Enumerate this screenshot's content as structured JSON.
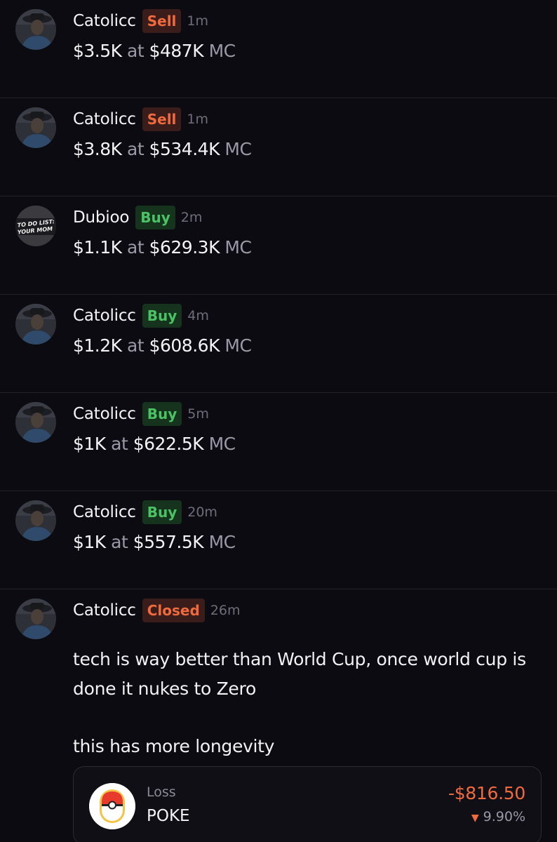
{
  "trades": [
    {
      "user": "Catolicc",
      "action": "Sell",
      "time": "1m",
      "amount": "$3.5K",
      "at": "at",
      "mc": "$487K",
      "mc_suffix": "MC"
    },
    {
      "user": "Catolicc",
      "action": "Sell",
      "time": "1m",
      "amount": "$3.8K",
      "at": "at",
      "mc": "$534.4K",
      "mc_suffix": "MC"
    },
    {
      "user": "Dubioo",
      "action": "Buy",
      "time": "2m",
      "amount": "$1.1K",
      "at": "at",
      "mc": "$629.3K",
      "mc_suffix": "MC",
      "avatar_text": [
        "TO DO LIST:",
        "YOUR MOM"
      ]
    },
    {
      "user": "Catolicc",
      "action": "Buy",
      "time": "4m",
      "amount": "$1.2K",
      "at": "at",
      "mc": "$608.6K",
      "mc_suffix": "MC"
    },
    {
      "user": "Catolicc",
      "action": "Buy",
      "time": "5m",
      "amount": "$1K",
      "at": "at",
      "mc": "$622.5K",
      "mc_suffix": "MC"
    },
    {
      "user": "Catolicc",
      "action": "Buy",
      "time": "20m",
      "amount": "$1K",
      "at": "at",
      "mc": "$557.5K",
      "mc_suffix": "MC"
    }
  ],
  "closed_post": {
    "user": "Catolicc",
    "action": "Closed",
    "time": "26m",
    "message_line1": "tech is way better than World Cup, once world cup is done it nukes to Zero",
    "message_line2": "this has more longevity",
    "card": {
      "label": "Loss",
      "ticker": "POKE",
      "pnl": "-$816.50",
      "pct": "9.90%",
      "pct_icon": "down-triangle-icon"
    }
  },
  "colors": {
    "background": "#0c0b12",
    "sell": "#f06a3e",
    "buy": "#4bc264",
    "muted": "#9a99a5"
  }
}
